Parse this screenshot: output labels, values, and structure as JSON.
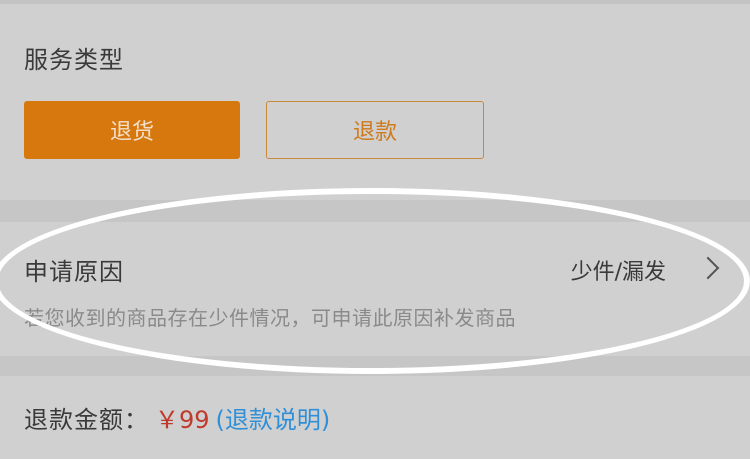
{
  "service_type": {
    "title": "服务类型",
    "options": [
      {
        "label": "退货",
        "selected": true
      },
      {
        "label": "退款",
        "selected": false
      }
    ]
  },
  "reason": {
    "label": "申请原因",
    "value": "少件/漏发",
    "hint": "若您收到的商品存在少件情况，可申请此原因补发商品",
    "icon": "chevron-right-icon"
  },
  "refund": {
    "label": "退款金额：",
    "amount": "￥99",
    "link": "(退款说明)"
  },
  "colors": {
    "accent": "#d7780f",
    "price": "#c0392b",
    "link": "#2f8fd8",
    "annotation": "#ffffff"
  }
}
